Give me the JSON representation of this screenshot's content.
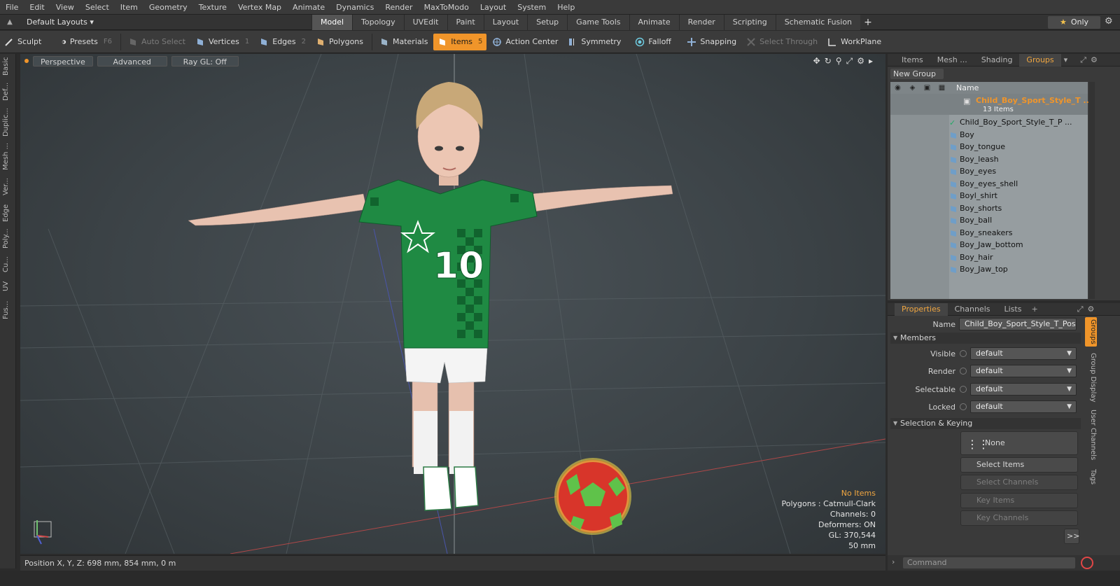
{
  "menu": [
    "File",
    "Edit",
    "View",
    "Select",
    "Item",
    "Geometry",
    "Texture",
    "Vertex Map",
    "Animate",
    "Dynamics",
    "Render",
    "MaxToModo",
    "Layout",
    "System",
    "Help"
  ],
  "layout_selector": "Default Layouts",
  "layout_tabs": [
    {
      "label": "Model",
      "active": true
    },
    {
      "label": "Topology"
    },
    {
      "label": "UVEdit"
    },
    {
      "label": "Paint"
    },
    {
      "label": "Layout"
    },
    {
      "label": "Setup"
    },
    {
      "label": "Game Tools"
    },
    {
      "label": "Animate"
    },
    {
      "label": "Render"
    },
    {
      "label": "Scripting"
    },
    {
      "label": "Schematic Fusion"
    }
  ],
  "only_label": "Only",
  "toolbar": {
    "sculpt": "Sculpt",
    "presets": "Presets",
    "presets_key": "F6",
    "auto_select": "Auto Select",
    "vertices": "Vertices",
    "vertices_key": "1",
    "edges": "Edges",
    "edges_key": "2",
    "polygons": "Polygons",
    "materials": "Materials",
    "items": "Items",
    "items_key": "5",
    "action_center": "Action Center",
    "symmetry": "Symmetry",
    "falloff": "Falloff",
    "snapping": "Snapping",
    "select_through": "Select Through",
    "workplane": "WorkPlane"
  },
  "left_tabs": [
    "Basic",
    "Def...",
    "Duplic...",
    "Mesh ...",
    "Ver...",
    "Edge",
    "Poly...",
    "Cu...",
    "UV",
    "Fus..."
  ],
  "viewport": {
    "perspective": "Perspective",
    "advanced": "Advanced",
    "raygl": "Ray GL: Off",
    "info": {
      "no_items": "No Items",
      "polygons": "Polygons : Catmull-Clark",
      "channels": "Channels: 0",
      "deformers": "Deformers: ON",
      "gl": "GL: 370,544",
      "scale": "50 mm"
    },
    "jersey_number": "10"
  },
  "status": "Position X, Y, Z:  698 mm, 854 mm, 0 m",
  "right_top": {
    "tabs": [
      {
        "label": "Items"
      },
      {
        "label": "Mesh ..."
      },
      {
        "label": "Shading"
      },
      {
        "label": "Groups",
        "active": true
      }
    ],
    "new_group": "New Group",
    "name_header": "Name",
    "group_name": "Child_Boy_Sport_Style_T ...",
    "group_count": "13 Items",
    "items": [
      "Child_Boy_Sport_Style_T_P ...",
      "Boy",
      "Boy_tongue",
      "Boy_leash",
      "Boy_eyes",
      "Boy_eyes_shell",
      "Boyl_shirt",
      "Boy_shorts",
      "Boy_ball",
      "Boy_sneakers",
      "Boy_Jaw_bottom",
      "Boy_hair",
      "Boy_Jaw_top"
    ]
  },
  "right_bottom": {
    "tabs": [
      {
        "label": "Properties",
        "active": true
      },
      {
        "label": "Channels"
      },
      {
        "label": "Lists"
      }
    ],
    "name_label": "Name",
    "name_value": "Child_Boy_Sport_Style_T_Pose (:",
    "members_section": "Members",
    "visible_label": "Visible",
    "visible_value": "default",
    "render_label": "Render",
    "render_value": "default",
    "selectable_label": "Selectable",
    "selectable_value": "default",
    "locked_label": "Locked",
    "locked_value": "default",
    "sel_keying_section": "Selection & Keying",
    "none_label": "None",
    "select_items": "Select Items",
    "select_channels": "Select Channels",
    "key_items": "Key Items",
    "key_channels": "Key Channels",
    "more": ">>",
    "side_tabs": [
      "Groups",
      "Group Display",
      "User Channels",
      "Tags"
    ]
  },
  "command_placeholder": "Command"
}
